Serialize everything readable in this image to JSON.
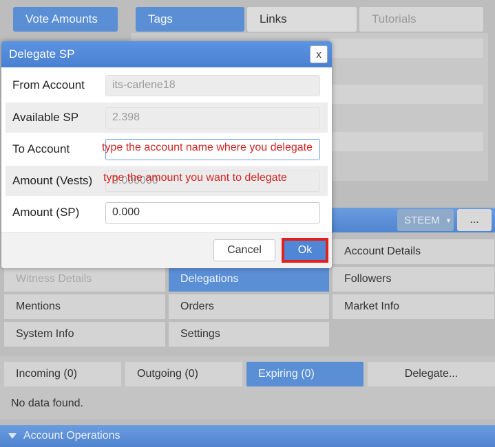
{
  "top_tabs": {
    "vote_amounts": "Vote Amounts",
    "tags": "Tags",
    "links": "Links",
    "tutorials": "Tutorials"
  },
  "modal": {
    "title": "Delegate SP",
    "close": "x",
    "fields": {
      "from_account": {
        "label": "From Account",
        "value": "its-carlene18"
      },
      "available_sp": {
        "label": "Available SP",
        "value": "2.398"
      },
      "to_account": {
        "label": "To Account",
        "value": ""
      },
      "amount_vests": {
        "label": "Amount (Vests)",
        "value": "0.000000"
      },
      "amount_sp": {
        "label": "Amount (SP)",
        "value": "0.000"
      }
    },
    "annotations": {
      "to_account": "type the account name where you delegate",
      "amount": "type the amount you want to delegate"
    },
    "cancel": "Cancel",
    "ok": "Ok"
  },
  "account_bar": {
    "currency": "STEEM",
    "currency_arrow": "▾",
    "more": "..."
  },
  "nav": {
    "account_details": "Account Details",
    "witness_details": "Witness Details",
    "delegations": "Delegations",
    "followers": "Followers",
    "mentions": "Mentions",
    "orders": "Orders",
    "market_info": "Market Info",
    "system_info": "System Info",
    "settings": "Settings"
  },
  "delegation_tabs": {
    "incoming": "Incoming (0)",
    "outgoing": "Outgoing (0)",
    "expiring": "Expiring (0)",
    "delegate": "Delegate..."
  },
  "no_data": "No data found.",
  "account_operations": "Account Operations",
  "colors": {
    "accent": "#5a8fd6",
    "highlight_box": "#e2201c",
    "annotation": "#d42424"
  }
}
